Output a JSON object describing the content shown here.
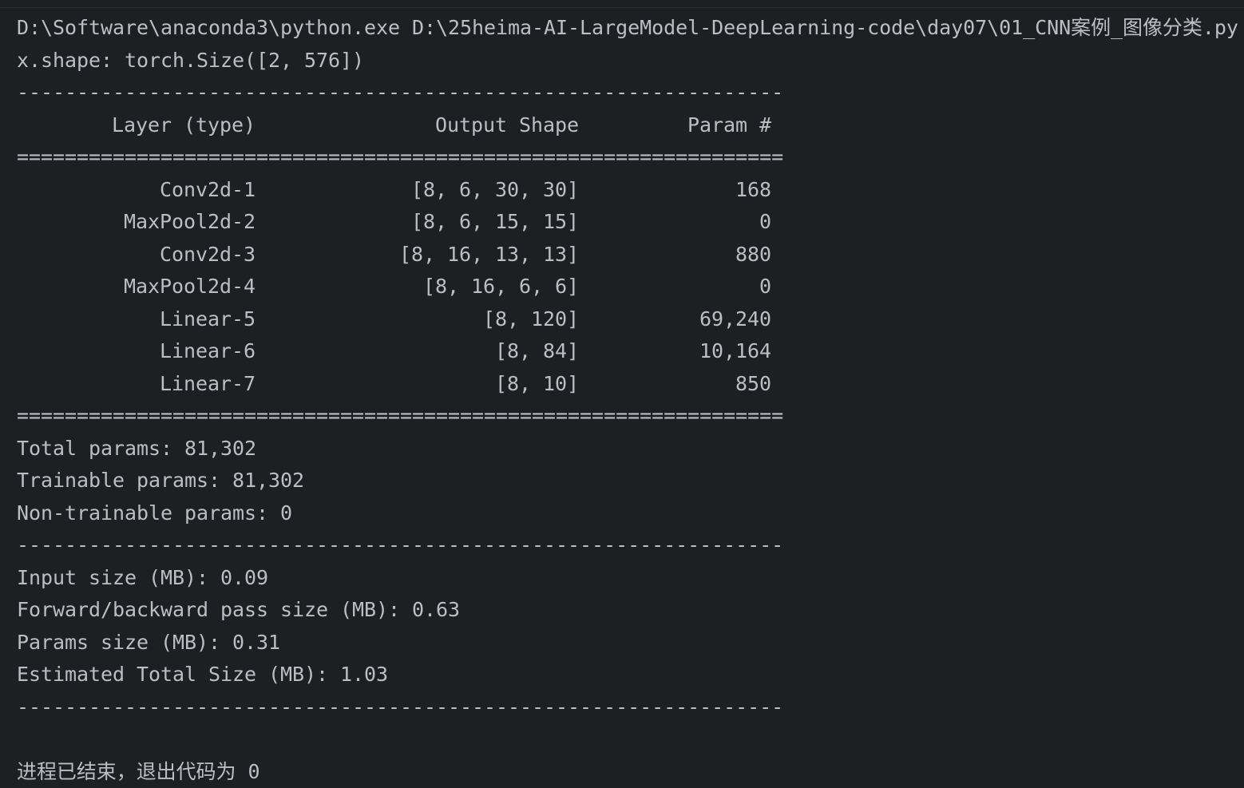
{
  "console": {
    "command_line": "D:\\Software\\anaconda3\\python.exe D:\\25heima-AI-LargeModel-DeepLearning-code\\day07\\01_CNN案例_图像分类.py",
    "shape_line": "x.shape: torch.Size([2, 576])",
    "dash_separator": "----------------------------------------------------------------",
    "eq_separator": "================================================================",
    "header": {
      "layer": "Layer (type)",
      "output_shape": "Output Shape",
      "param": "Param #"
    },
    "layers": [
      {
        "layer": "Conv2d-1",
        "output_shape": "[8, 6, 30, 30]",
        "param": "168"
      },
      {
        "layer": "MaxPool2d-2",
        "output_shape": "[8, 6, 15, 15]",
        "param": "0"
      },
      {
        "layer": "Conv2d-3",
        "output_shape": "[8, 16, 13, 13]",
        "param": "880"
      },
      {
        "layer": "MaxPool2d-4",
        "output_shape": "[8, 16, 6, 6]",
        "param": "0"
      },
      {
        "layer": "Linear-5",
        "output_shape": "[8, 120]",
        "param": "69,240"
      },
      {
        "layer": "Linear-6",
        "output_shape": "[8, 84]",
        "param": "10,164"
      },
      {
        "layer": "Linear-7",
        "output_shape": "[8, 10]",
        "param": "850"
      }
    ],
    "totals": {
      "total_params": "Total params: 81,302",
      "trainable_params": "Trainable params: 81,302",
      "non_trainable_params": "Non-trainable params: 0"
    },
    "sizes": {
      "input_size": "Input size (MB): 0.09",
      "forward_backward": "Forward/backward pass size (MB): 0.63",
      "params_size": "Params size (MB): 0.31",
      "estimated_total": "Estimated Total Size (MB): 1.03"
    },
    "exit_message": "进程已结束，退出代码为 0"
  },
  "colors": {
    "background": "#1e1f22",
    "text": "#bcbec4"
  }
}
